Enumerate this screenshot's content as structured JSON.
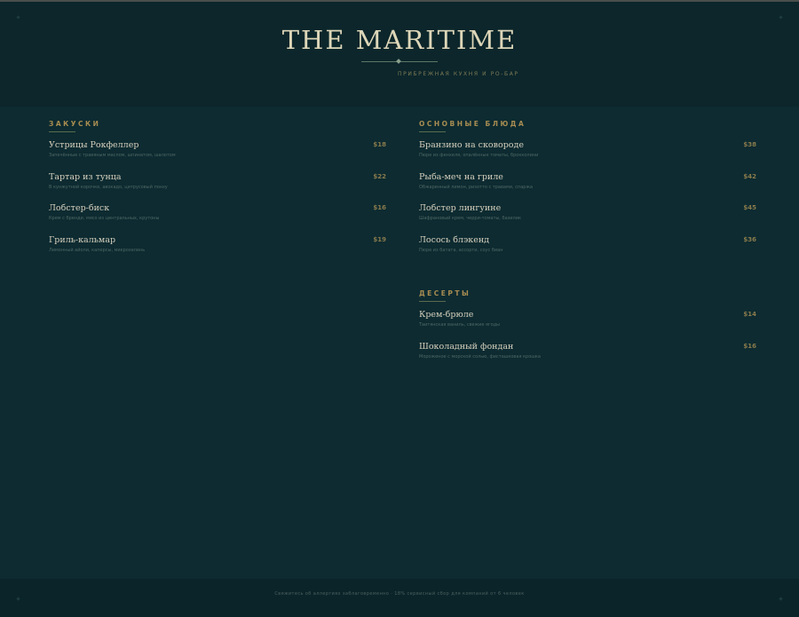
{
  "header": {
    "title": "THE MARITIME",
    "tagline": "ПРИБРЕЖНАЯ КУХНЯ И РО-БАР"
  },
  "sections": [
    {
      "title": "ЗАКУСКИ",
      "items": [
        {
          "name": "Устрицы Рокфеллер",
          "price": "$18",
          "desc": "Запечённые с травяным маслом, шпинатом, шалотом"
        },
        {
          "name": "Тартар из тунца",
          "price": "$22",
          "desc": "В кунжутной корочке, авокадо, цитрусовый понзу"
        },
        {
          "name": "Лобстер-биск",
          "price": "$16",
          "desc": "Крем с бренди, мясо из центральных, крутоны"
        },
        {
          "name": "Гриль-кальмар",
          "price": "$19",
          "desc": "Лимонный айоли, каперсы, микрозелень"
        }
      ]
    },
    {
      "title": "ОСНОВНЫЕ БЛЮДА",
      "items": [
        {
          "name": "Бранзино на сковороде",
          "price": "$38",
          "desc": "Пюре из фенхеля, опалённые томаты, брокколини"
        },
        {
          "name": "Рыба-меч на гриле",
          "price": "$42",
          "desc": "Обжаренный лимон, ризотто с травами, спаржа"
        },
        {
          "name": "Лобстер лингуине",
          "price": "$45",
          "desc": "Шафрановый крем, черри-томаты, базилик"
        },
        {
          "name": "Лосось блэкенд",
          "price": "$36",
          "desc": "Пюре из батата, ассорти, соус биан"
        }
      ]
    },
    {
      "title": "ДЕСЕРТЫ",
      "items": [
        {
          "name": "Крем-брюле",
          "price": "$14",
          "desc": "Таитянская ваниль, свежие ягоды"
        },
        {
          "name": "Шоколадный фондан",
          "price": "$16",
          "desc": "Мороженое с морской солью, фисташковая крошка"
        }
      ]
    }
  ],
  "footer": {
    "text": "Свяжитесь об аллергиях заблаговременно  ·  18% сервисный сбор для компаний от 6 человек"
  }
}
